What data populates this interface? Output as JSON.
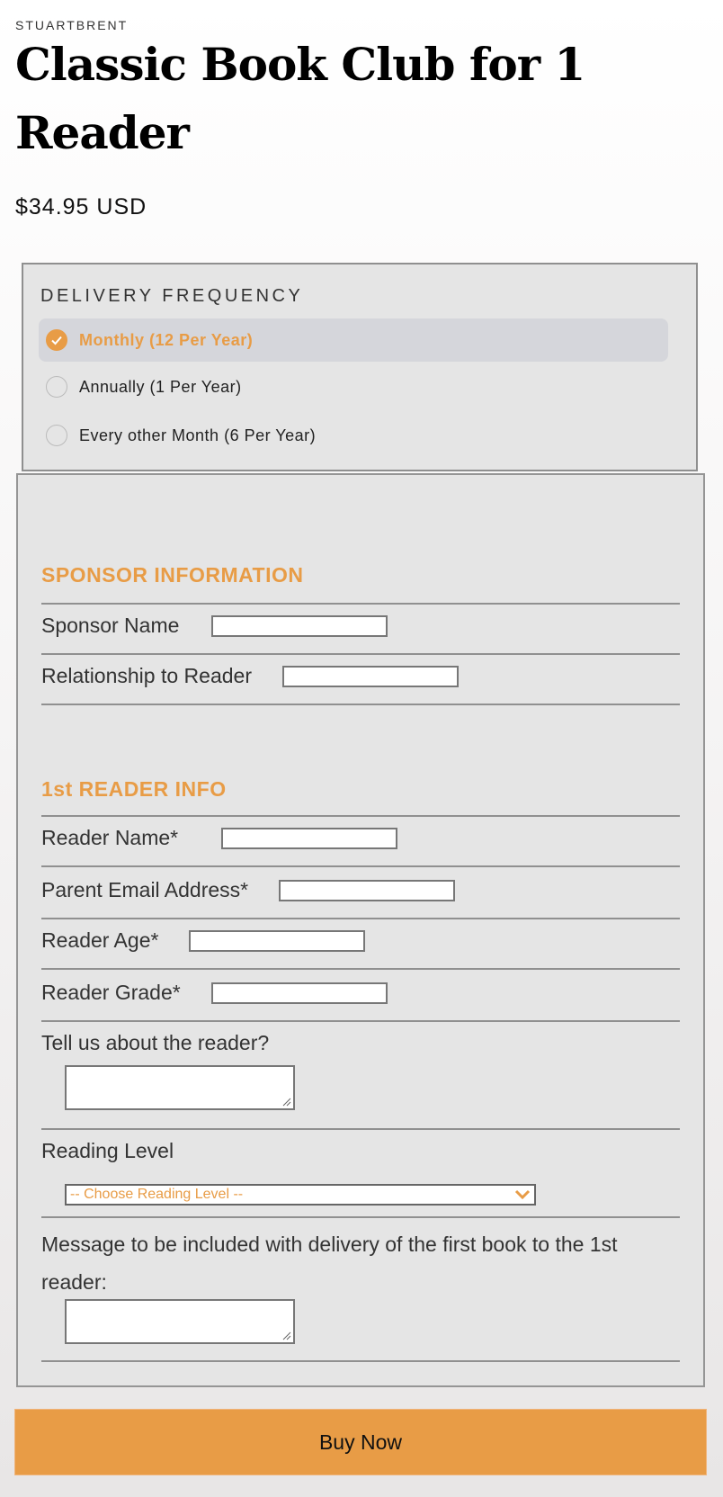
{
  "product": {
    "vendor": "STUARTBRENT",
    "title": "Classic Book Club for 1 Reader",
    "price": "$34.95 USD"
  },
  "delivery_frequency": {
    "legend": "DELIVERY FREQUENCY",
    "options": [
      {
        "label": "Monthly (12 Per Year)",
        "selected": true
      },
      {
        "label": "Annually (1 Per Year)",
        "selected": false
      },
      {
        "label": "Every other Month (6 Per Year)",
        "selected": false
      }
    ]
  },
  "sponsor": {
    "heading": "SPONSOR INFORMATION",
    "fields": [
      {
        "label": "Sponsor Name",
        "value": ""
      },
      {
        "label": "Relationship to Reader",
        "value": ""
      }
    ]
  },
  "reader": {
    "heading": "1st READER INFO",
    "fields": [
      {
        "label": "Reader Name*",
        "value": ""
      },
      {
        "label": "Parent Email Address*",
        "value": ""
      },
      {
        "label": "Reader Age*",
        "value": ""
      },
      {
        "label": "Reader Grade*",
        "value": ""
      }
    ],
    "about_label": "Tell us about the reader?",
    "about_value": "",
    "reading_level_label": "Reading Level",
    "reading_level_selected": "-- Choose Reading Level --",
    "message_label": "Message to be included with delivery of the first book to the 1st reader:",
    "message_value": ""
  },
  "buy_button": "Buy Now",
  "colors": {
    "accent": "#e89c46",
    "panel": "#e5e5e5",
    "border": "#909090"
  }
}
